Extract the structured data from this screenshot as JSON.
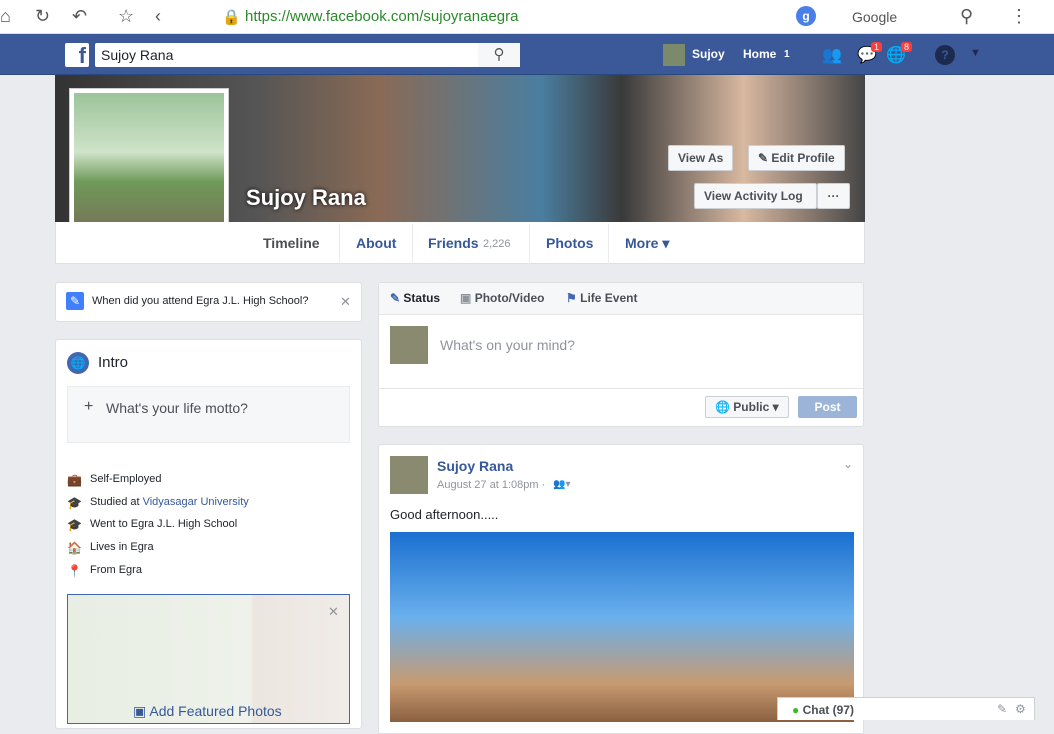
{
  "browser": {
    "url": "https://www.facebook.com/sujoyranaegra",
    "search_engine": "Google"
  },
  "fb": {
    "search_value": "Sujoy Rana",
    "user": "Sujoy",
    "home": "Home",
    "home_count": "1",
    "messages_count": "1",
    "notifications_count": "8"
  },
  "profile": {
    "name": "Sujoy Rana",
    "view_as": "View As",
    "edit_profile": "Edit Profile",
    "activity_log": "View Activity Log",
    "more_dots": "···"
  },
  "tabs": [
    {
      "label": "Timeline"
    },
    {
      "label": "About"
    },
    {
      "label": "Friends",
      "count": "2,226"
    },
    {
      "label": "Photos"
    },
    {
      "label": "More ▾"
    }
  ],
  "prompt": {
    "text": "When did you attend Egra J.L. High School?"
  },
  "intro": {
    "title": "Intro",
    "motto": "What's your life motto?",
    "items": [
      {
        "icon": "briefcase-icon",
        "prefix": "Self-Employed",
        "link": ""
      },
      {
        "icon": "graduation-cap-icon",
        "prefix": "Studied at ",
        "link": "Vidyasagar University"
      },
      {
        "icon": "graduation-cap-icon",
        "prefix": "Went to Egra J.L. High School",
        "link": ""
      },
      {
        "icon": "home-icon",
        "prefix": "Lives in Egra",
        "link": ""
      },
      {
        "icon": "pin-icon",
        "prefix": "From Egra",
        "link": ""
      }
    ],
    "featured": "Add Featured Photos"
  },
  "composer": {
    "status": "Status",
    "photo": "Photo/Video",
    "life": "Life Event",
    "placeholder": "What's on your mind?",
    "privacy": "Public ▾",
    "post": "Post"
  },
  "post": {
    "author": "Sujoy Rana",
    "time": "August 27 at 1:08pm · ",
    "text": "Good afternoon....."
  },
  "chat": {
    "label": "Chat (97)"
  }
}
